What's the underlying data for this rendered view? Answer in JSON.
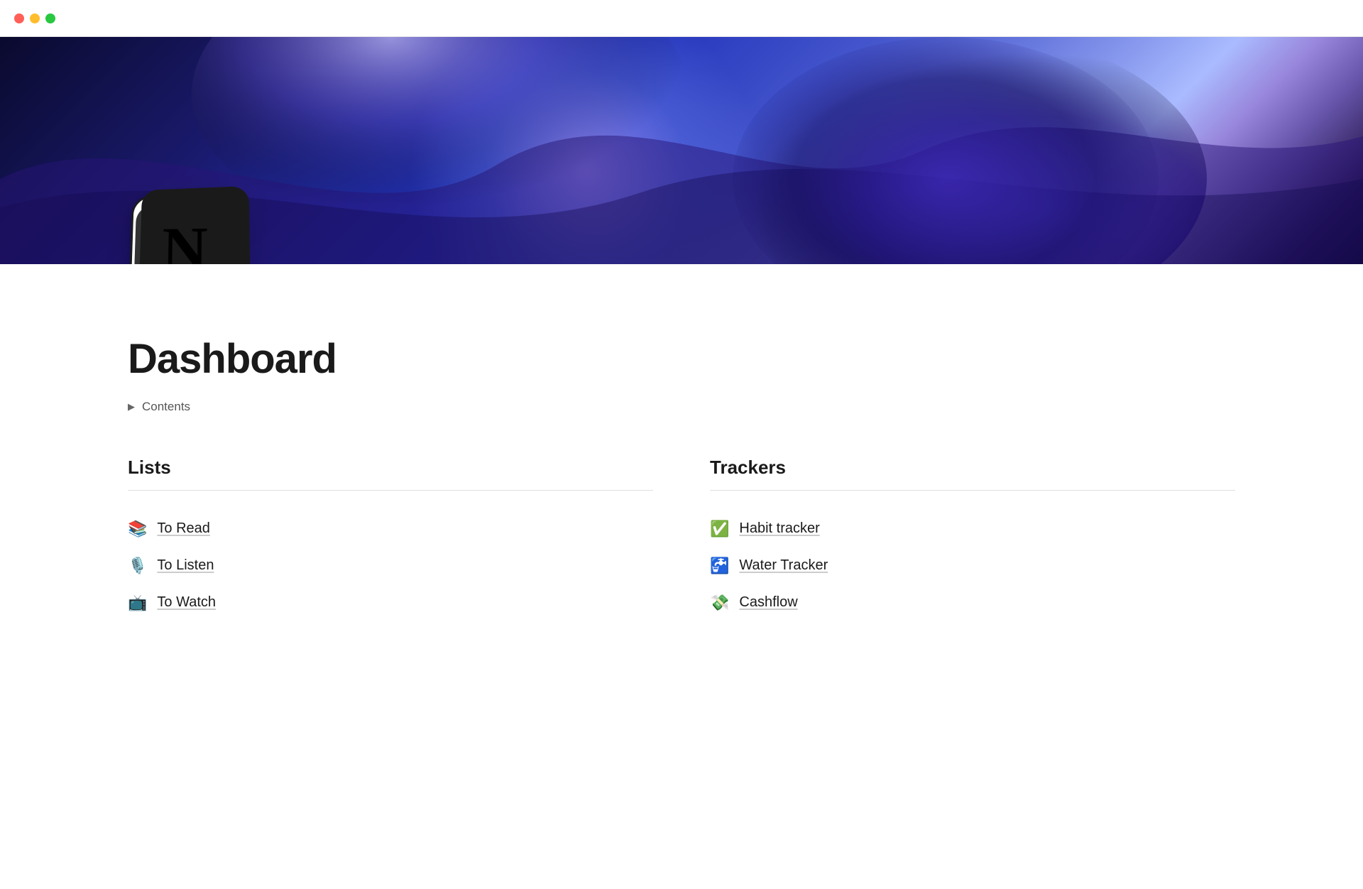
{
  "window": {
    "traffic_lights": [
      {
        "color": "#ff5f57",
        "label": "close"
      },
      {
        "color": "#ffbd2e",
        "label": "minimize"
      },
      {
        "color": "#28c840",
        "label": "maximize"
      }
    ]
  },
  "hero": {
    "alt": "Abstract blue gradient wave background"
  },
  "logo": {
    "letter": "N",
    "alt": "Notion logo"
  },
  "page": {
    "title": "Dashboard",
    "contents_label": "Contents"
  },
  "lists_section": {
    "heading": "Lists",
    "items": [
      {
        "emoji": "📚",
        "text": "To Read"
      },
      {
        "emoji": "🎙️",
        "text": "To Listen"
      },
      {
        "emoji": "📺",
        "text": "To Watch"
      }
    ]
  },
  "trackers_section": {
    "heading": "Trackers",
    "items": [
      {
        "emoji": "✅",
        "text": "Habit tracker"
      },
      {
        "emoji": "🚰",
        "text": "Water Tracker"
      },
      {
        "emoji": "💸",
        "text": "Cashflow"
      }
    ]
  }
}
